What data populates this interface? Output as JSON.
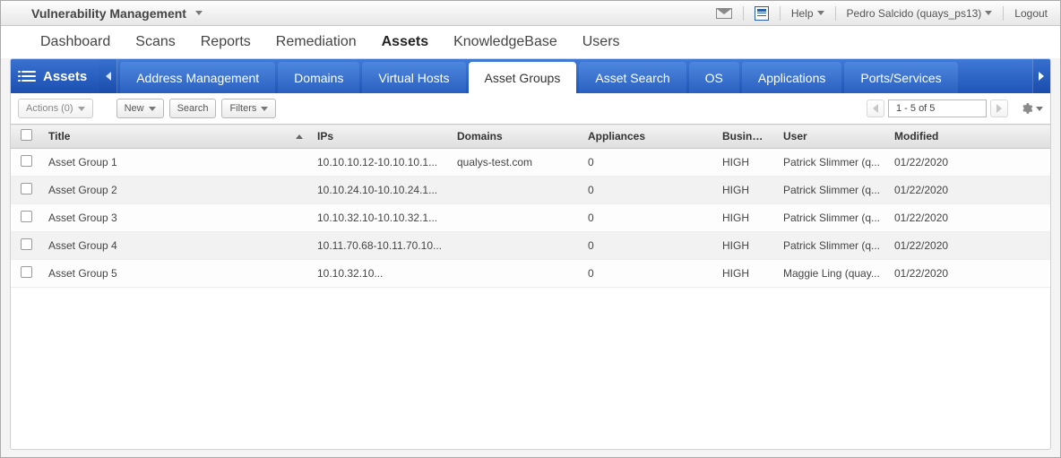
{
  "top": {
    "app_name": "Vulnerability Management",
    "help_label": "Help",
    "user_label": "Pedro Salcido (quays_ps13)",
    "logout_label": "Logout"
  },
  "mainnav": {
    "items": [
      "Dashboard",
      "Scans",
      "Reports",
      "Remediation",
      "Assets",
      "KnowledgeBase",
      "Users"
    ],
    "active_index": 4
  },
  "subnav": {
    "title": "Assets",
    "tabs": [
      "Address Management",
      "Domains",
      "Virtual Hosts",
      "Asset Groups",
      "Asset Search",
      "OS",
      "Applications",
      "Ports/Services"
    ],
    "active_index": 3
  },
  "toolbar": {
    "actions_label": "Actions (0)",
    "new_label": "New",
    "search_label": "Search",
    "filters_label": "Filters",
    "pager_text": "1 - 5 of 5"
  },
  "table": {
    "columns": [
      "Title",
      "IPs",
      "Domains",
      "Appliances",
      "Busines…",
      "User",
      "Modified"
    ],
    "rows": [
      {
        "title": "Asset Group 1",
        "ips": "10.10.10.12-10.10.10.1...",
        "domains": "qualys-test.com",
        "appliances": "0",
        "business": "HIGH",
        "user": "Patrick Slimmer (q...",
        "modified": "01/22/2020"
      },
      {
        "title": "Asset Group 2",
        "ips": "10.10.24.10-10.10.24.1...",
        "domains": "",
        "appliances": "0",
        "business": "HIGH",
        "user": "Patrick Slimmer (q...",
        "modified": "01/22/2020"
      },
      {
        "title": "Asset Group 3",
        "ips": "10.10.32.10-10.10.32.1...",
        "domains": "",
        "appliances": "0",
        "business": "HIGH",
        "user": "Patrick Slimmer (q...",
        "modified": "01/22/2020"
      },
      {
        "title": "Asset Group 4",
        "ips": "10.11.70.68-10.11.70.10...",
        "domains": "",
        "appliances": "0",
        "business": "HIGH",
        "user": "Patrick Slimmer (q...",
        "modified": "01/22/2020"
      },
      {
        "title": "Asset Group 5",
        "ips": "10.10.32.10...",
        "domains": "",
        "appliances": "0",
        "business": "HIGH",
        "user": "Maggie Ling (quay...",
        "modified": "01/22/2020"
      }
    ]
  }
}
